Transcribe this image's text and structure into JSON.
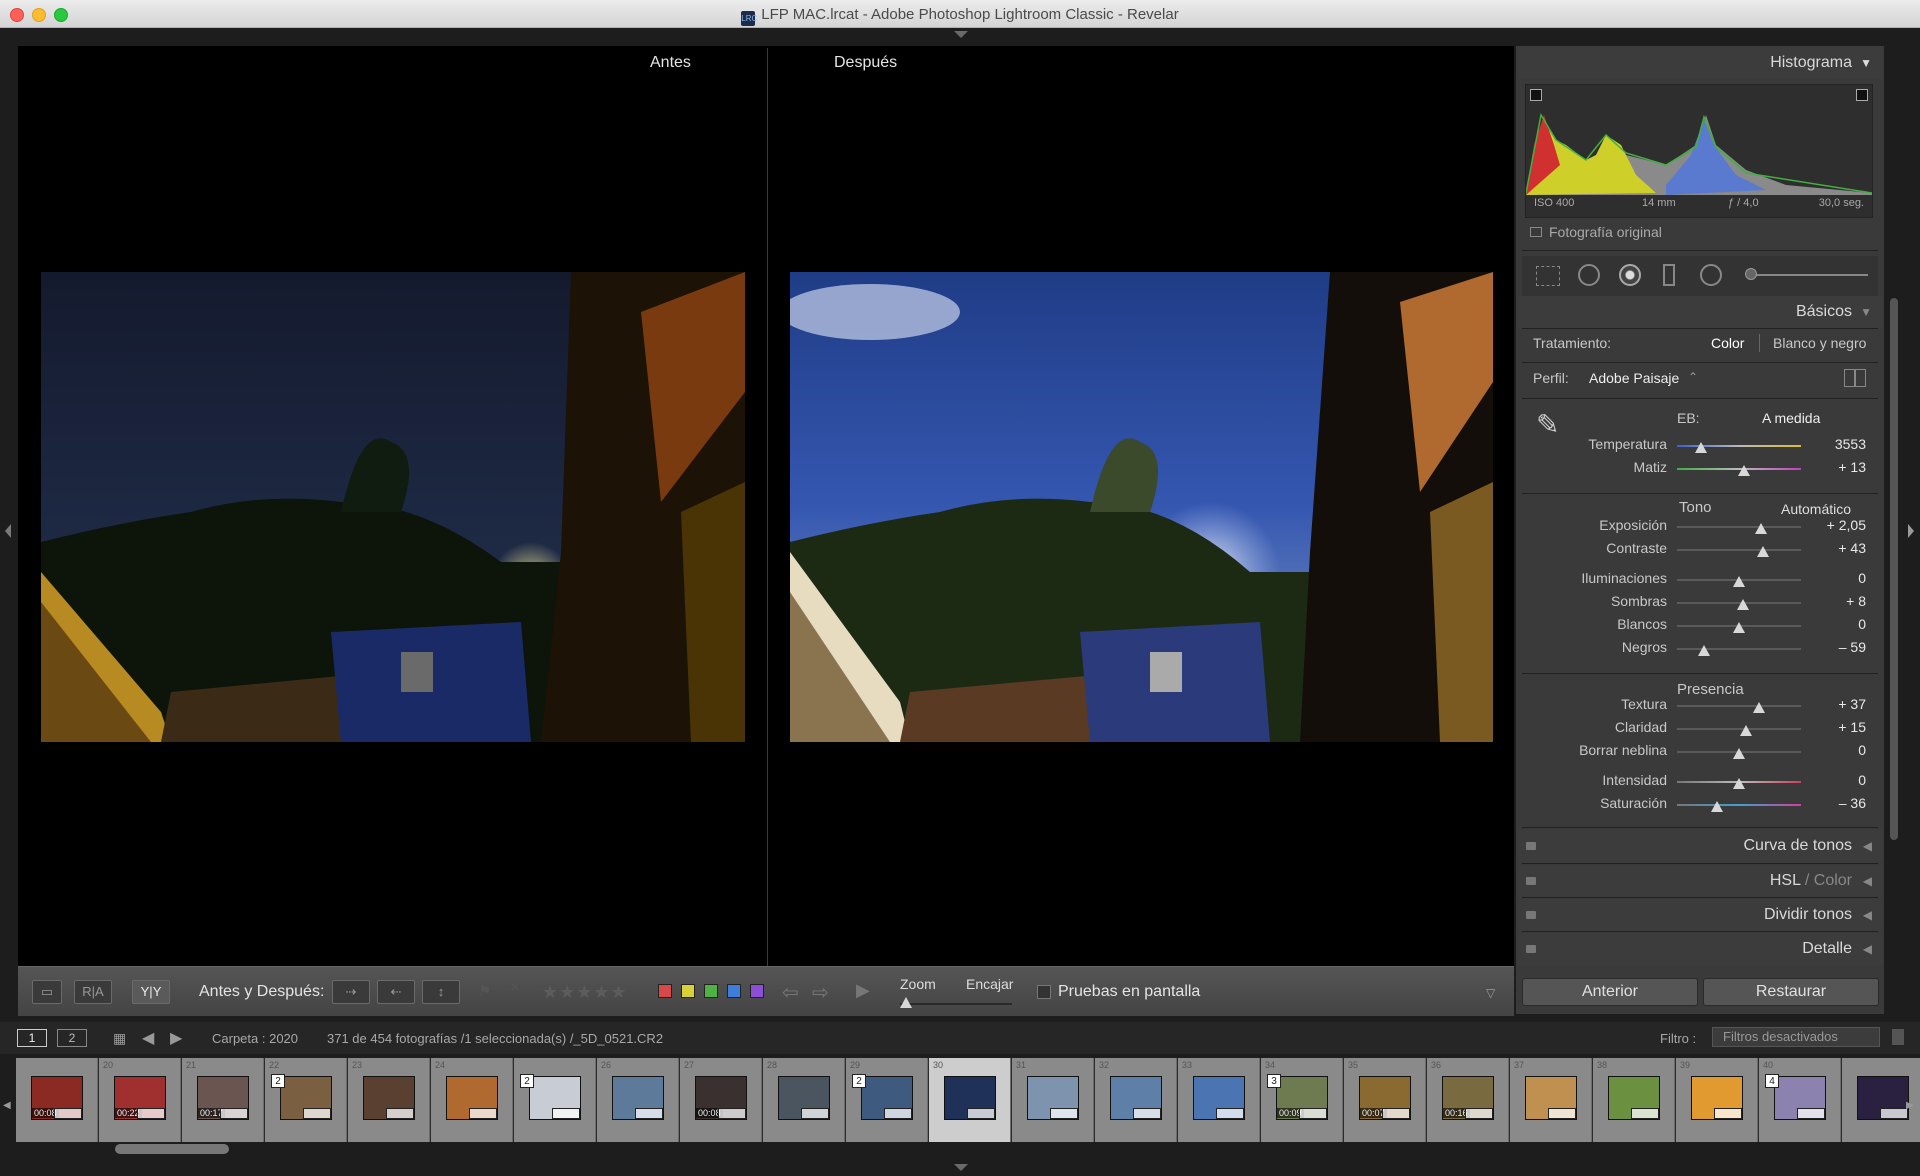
{
  "window": {
    "title": "LFP MAC.lrcat - Adobe Photoshop Lightroom Classic - Revelar",
    "doc_icon": "LRC"
  },
  "viewer": {
    "before_label": "Antes",
    "after_label": "Después"
  },
  "toolbar": {
    "view_loupe": "▭",
    "view_ra": "R|A",
    "view_yy": "Y|Y",
    "before_after_label": "Antes y Después:",
    "stars": "★★★★★",
    "zoom_label": "Zoom",
    "fit_label": "Encajar",
    "proof_label": "Pruebas en pantalla",
    "color_labels": [
      "#d94848",
      "#d9cf37",
      "#4fb343",
      "#3d7ddb",
      "#8d4ed6"
    ]
  },
  "filmbar": {
    "screen1": "1",
    "screen2": "2",
    "folder": "Carpeta : 2020",
    "count": "371 de 454 fotografías /1 seleccionada(s) /_5D_0521.CR2",
    "filter_label": "Filtro :",
    "filter_value": "Filtros desactivados"
  },
  "filmstrip": [
    {
      "n": "",
      "badge": "",
      "time": "00:08",
      "color": "#8a2a22"
    },
    {
      "n": "20",
      "badge": "",
      "time": "00:22",
      "color": "#a03030"
    },
    {
      "n": "21",
      "badge": "",
      "time": "00:17",
      "color": "#6a5550"
    },
    {
      "n": "22",
      "badge": "2",
      "time": "",
      "color": "#7a6040"
    },
    {
      "n": "23",
      "badge": "",
      "time": "",
      "color": "#5a4030"
    },
    {
      "n": "24",
      "badge": "",
      "time": "",
      "color": "#b06a30"
    },
    {
      "n": "",
      "badge": "2",
      "time": "",
      "color": "#c8ccd4"
    },
    {
      "n": "26",
      "badge": "",
      "time": "",
      "color": "#5e7a9a"
    },
    {
      "n": "27",
      "badge": "",
      "time": "00:08",
      "color": "#3a3030"
    },
    {
      "n": "28",
      "badge": "",
      "time": "",
      "color": "#4a5560"
    },
    {
      "n": "29",
      "badge": "2",
      "time": "",
      "color": "#3e5a7e"
    },
    {
      "n": "30",
      "badge": "",
      "time": "",
      "color": "#1f3158"
    },
    {
      "n": "31",
      "badge": "",
      "time": "",
      "color": "#7d93ae"
    },
    {
      "n": "32",
      "badge": "",
      "time": "",
      "color": "#5d7fa8"
    },
    {
      "n": "33",
      "badge": "",
      "time": "",
      "color": "#4b74b2"
    },
    {
      "n": "34",
      "badge": "3",
      "time": "00:09",
      "color": "#6e7a50"
    },
    {
      "n": "35",
      "badge": "",
      "time": "00:07",
      "color": "#8a6a30"
    },
    {
      "n": "36",
      "badge": "",
      "time": "00:16",
      "color": "#7a6a40"
    },
    {
      "n": "37",
      "badge": "",
      "time": "",
      "color": "#c09050"
    },
    {
      "n": "38",
      "badge": "",
      "time": "",
      "color": "#6a9040"
    },
    {
      "n": "39",
      "badge": "",
      "time": "",
      "color": "#e09a30"
    },
    {
      "n": "40",
      "badge": "4",
      "time": "",
      "color": "#8c82b0"
    },
    {
      "n": "",
      "badge": "",
      "time": "",
      "color": "#2a2040"
    }
  ],
  "panel": {
    "histogram_title": "Histograma",
    "iso": "ISO 400",
    "focal": "14 mm",
    "aperture": "ƒ / 4,0",
    "shutter": "30,0 seg.",
    "original_photo": "Fotografía original",
    "basics_title": "Básicos",
    "treatment_label": "Tratamiento:",
    "treatment_color": "Color",
    "treatment_bw": "Blanco y negro",
    "profile_label": "Perfil:",
    "profile_value": "Adobe Paisaje",
    "wb_label": "EB:",
    "wb_value": "A medida",
    "tone_label": "Tono",
    "auto_label": "Automático",
    "presence_label": "Presencia",
    "sliders": [
      {
        "label": "Temperatura",
        "value": "3553",
        "pos": 0.19,
        "track": "temp"
      },
      {
        "label": "Matiz",
        "value": "+ 13",
        "pos": 0.54,
        "track": "tint"
      },
      {
        "label": "Exposición",
        "value": "+ 2,05",
        "pos": 0.68,
        "track": "plain"
      },
      {
        "label": "Contraste",
        "value": "+ 43",
        "pos": 0.69,
        "track": "plain"
      },
      {
        "label": "Iluminaciones",
        "value": "0",
        "pos": 0.5,
        "track": "plain"
      },
      {
        "label": "Sombras",
        "value": "+ 8",
        "pos": 0.53,
        "track": "plain"
      },
      {
        "label": "Blancos",
        "value": "0",
        "pos": 0.5,
        "track": "plain"
      },
      {
        "label": "Negros",
        "value": "– 59",
        "pos": 0.22,
        "track": "plain"
      },
      {
        "label": "Textura",
        "value": "+ 37",
        "pos": 0.66,
        "track": "plain"
      },
      {
        "label": "Claridad",
        "value": "+ 15",
        "pos": 0.56,
        "track": "plain"
      },
      {
        "label": "Borrar neblina",
        "value": "0",
        "pos": 0.5,
        "track": "plain"
      },
      {
        "label": "Intensidad",
        "value": "0",
        "pos": 0.5,
        "track": "vib"
      },
      {
        "label": "Saturación",
        "value": "– 36",
        "pos": 0.32,
        "track": "sat"
      }
    ],
    "tone_curve": "Curva de tonos",
    "hsl": "HSL",
    "hsl_color": "Color",
    "split_tone": "Dividir tonos",
    "detail": "Detalle",
    "prev_button": "Anterior",
    "reset_button": "Restaurar"
  }
}
